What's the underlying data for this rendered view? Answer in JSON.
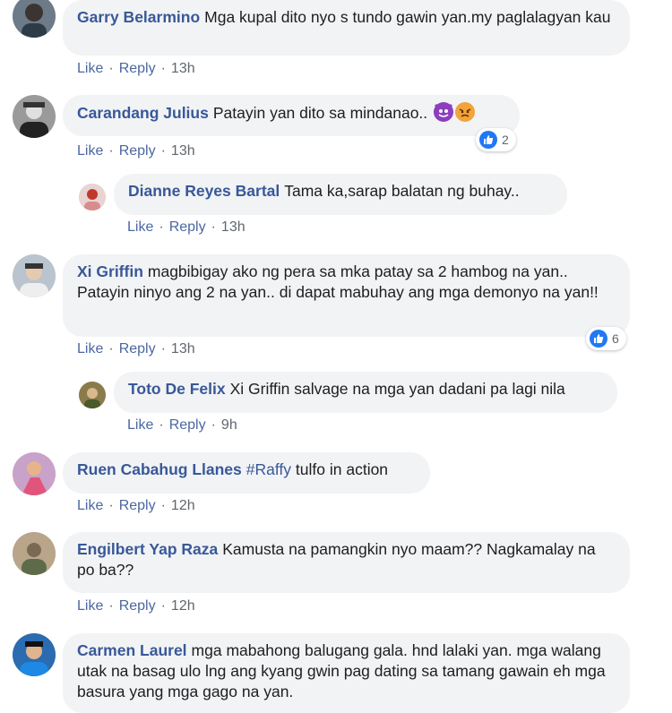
{
  "comments": [
    {
      "author": "Garry Belarmino",
      "text": "Mga kupal dito nyo s tundo gawin yan.my paglalagyan kau",
      "like": "Like",
      "reply": "Reply",
      "time": "13h"
    },
    {
      "author": "Carandang Julius",
      "text": "Patayin yan dito sa mindanao..",
      "like": "Like",
      "reply": "Reply",
      "time": "13h",
      "reaction_count": "2",
      "emojis": [
        "smiling-imp-emoji",
        "angry-face-emoji"
      ]
    },
    {
      "author": "Dianne Reyes Bartal",
      "text": "Tama ka,sarap balatan ng buhay..",
      "like": "Like",
      "reply": "Reply",
      "time": "13h"
    },
    {
      "author": "Xi Griffin",
      "text": "magbibigay ako ng pera sa mka patay sa 2 hambog na yan.. Patayin ninyo ang 2 na yan.. di dapat mabuhay ang mga demonyo na yan!!",
      "like": "Like",
      "reply": "Reply",
      "time": "13h",
      "reaction_count": "6"
    },
    {
      "author": "Toto De Felix",
      "text": "Xi Griffin salvage na mga yan dadani pa lagi nila",
      "like": "Like",
      "reply": "Reply",
      "time": "9h"
    },
    {
      "author": "Ruen Cabahug Llanes",
      "hashtag": "#Raffy",
      "text": "tulfo in action",
      "like": "Like",
      "reply": "Reply",
      "time": "12h"
    },
    {
      "author": "Engilbert Yap Raza",
      "text": "Kamusta na pamangkin nyo maam?? Nagkamalay na po ba??",
      "like": "Like",
      "reply": "Reply",
      "time": "12h"
    },
    {
      "author": "Carmen Laurel",
      "text": "mga mabahong balugang gala. hnd lalaki yan. mga walang utak na basag ulo lng ang kyang gwin pag dating sa tamang gawain eh mga basura yang mga gago na yan."
    }
  ],
  "colors": {
    "author": "#385898",
    "bubble": "#f2f3f5",
    "action_link": "#4b67a1",
    "like_badge": "#2078f4"
  },
  "icons": [
    "like-thumb-icon"
  ]
}
